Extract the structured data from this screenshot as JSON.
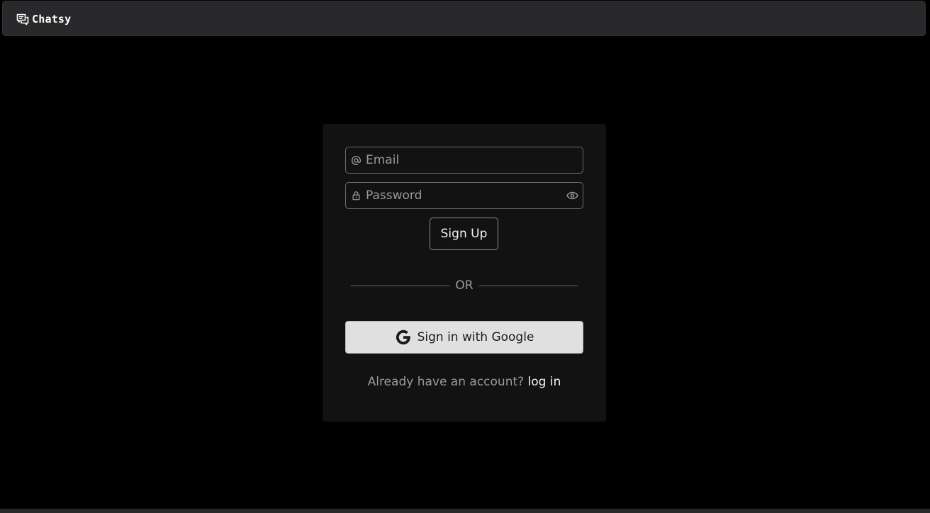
{
  "app": {
    "name": "Chatsy",
    "logo_icon": "chat-bubbles-icon"
  },
  "form": {
    "email": {
      "placeholder": "Email",
      "value": "",
      "icon": "at-icon"
    },
    "password": {
      "placeholder": "Password",
      "value": "",
      "icon": "lock-icon",
      "toggle_icon": "eye-icon"
    },
    "signup_label": "Sign Up",
    "divider_text": "OR",
    "google": {
      "label": "Sign in with Google",
      "icon": "google-icon"
    },
    "login_prompt": "Already have an account?",
    "login_link": "log in"
  },
  "colors": {
    "background": "#000000",
    "topbar": "#29292b",
    "card": "#121212",
    "google_button": "#e0e0e0"
  }
}
